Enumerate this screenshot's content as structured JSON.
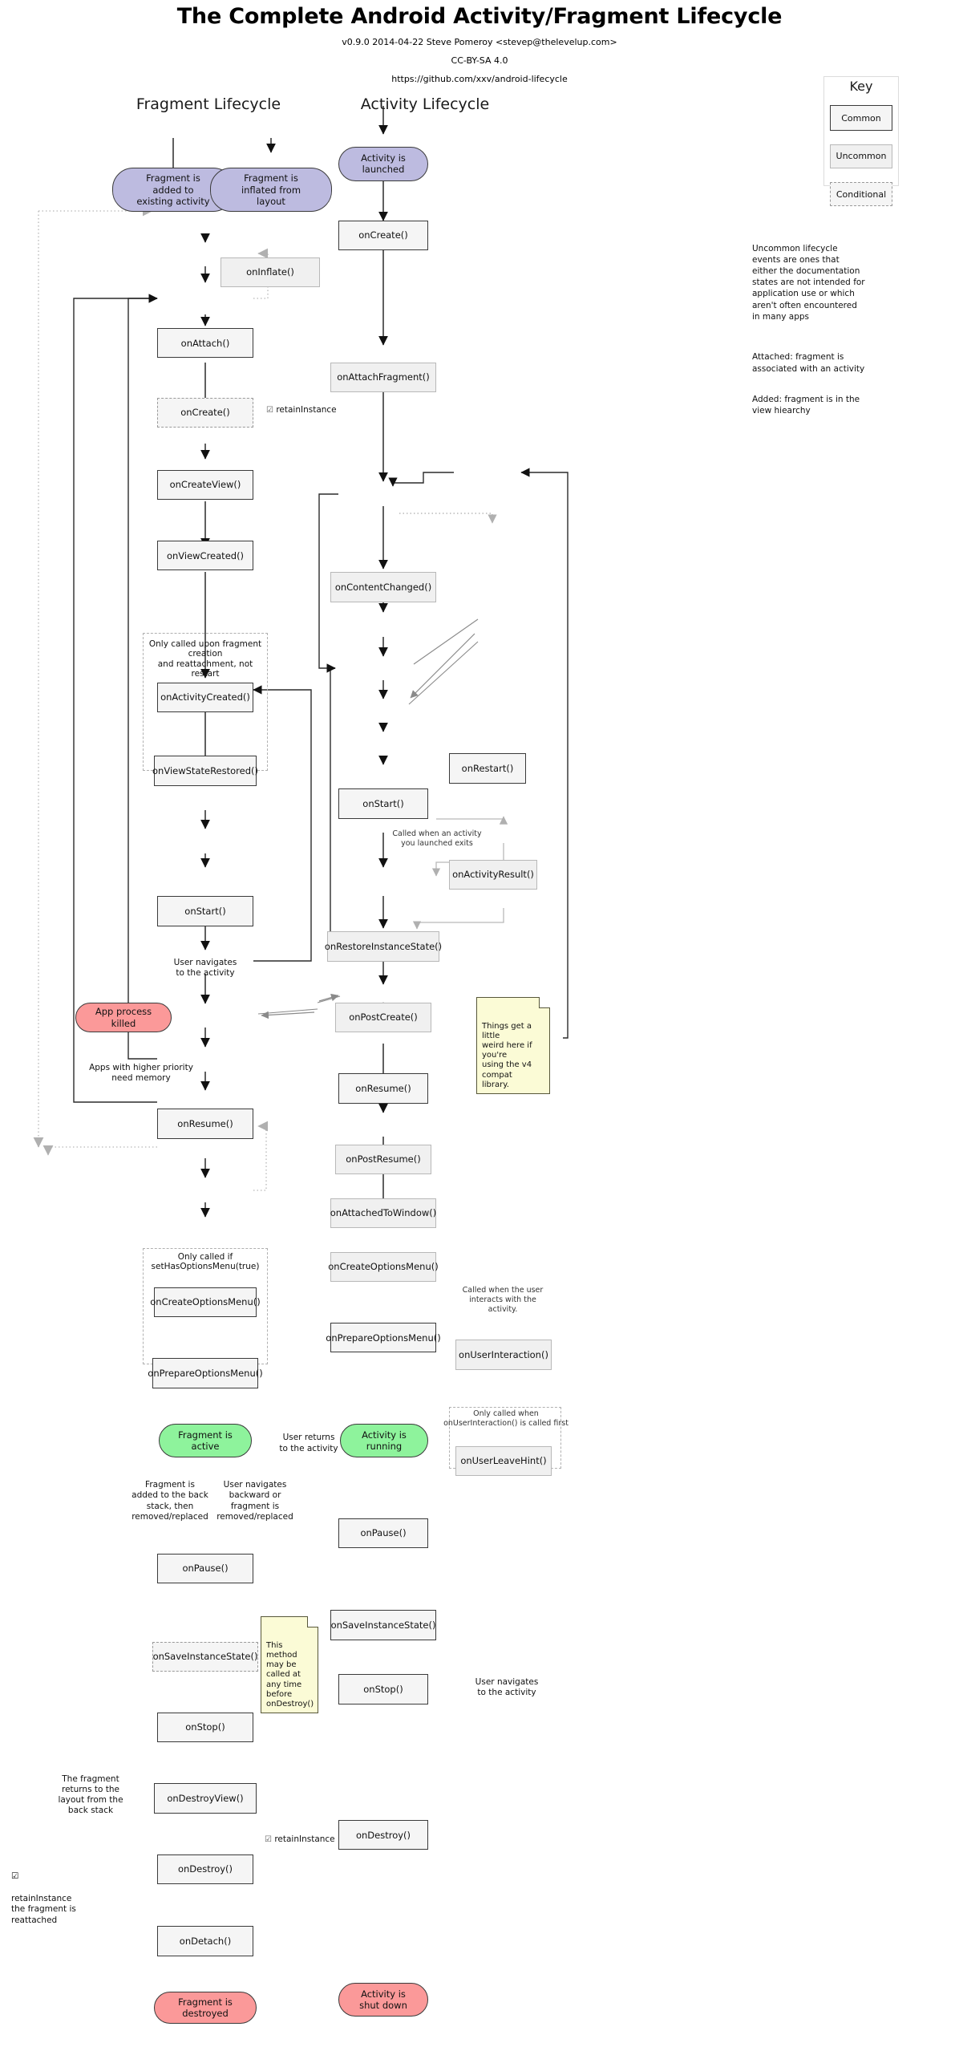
{
  "header": {
    "title": "The Complete Android Activity/Fragment Lifecycle",
    "version_line": "v0.9.0 2014-04-22 Steve Pomeroy <stevep@thelevelup.com>",
    "license_line": "CC-BY-SA 4.0",
    "url_line": "https://github.com/xxv/android-lifecycle"
  },
  "columns": {
    "fragment_title": "Fragment Lifecycle",
    "activity_title": "Activity Lifecycle"
  },
  "key": {
    "title": "Key",
    "items": [
      {
        "label": "Common",
        "style": "common"
      },
      {
        "label": "Uncommon",
        "style": "uncommon"
      },
      {
        "label": "Conditional",
        "style": "conditional"
      }
    ]
  },
  "notes_panel": {
    "uncommon_desc": "Uncommon lifecycle\nevents are ones that\neither the documentation\nstates are not intended for\napplication use or which\naren't often encountered\nin many apps",
    "attached_desc": "Attached: fragment is\nassociated with an activity",
    "added_desc": "Added: fragment is in the\nview hiearchy"
  },
  "fragment": {
    "start_added": "Fragment is\nadded to\nexisting activity",
    "start_inflated": "Fragment is\ninflated from\nlayout",
    "on_inflate": "onInflate()",
    "on_attach": "onAttach()",
    "on_create": "onCreate()",
    "on_create_view": "onCreateView()",
    "on_view_created": "onViewCreated()",
    "group_creation_label": "Only called upon fragment creation\nand reattachment, not restart",
    "on_activity_created": "onActivityCreated()",
    "on_view_state_restored": "onViewStateRestored()",
    "on_start": "onStart()",
    "label_user_navigates": "User navigates\nto the activity",
    "app_process_killed": "App process\nkilled",
    "label_higher_priority": "Apps with higher priority\nneed memory",
    "on_resume": "onResume()",
    "group_options_menu_label": "Only called if\nsetHasOptionsMenu(true)",
    "on_create_options_menu": "onCreateOptionsMenu()",
    "on_prepare_options_menu": "onPrepareOptionsMenu()",
    "fragment_active": "Fragment is\nactive",
    "label_back_stack": "Fragment is\nadded to the back\nstack, then\nremoved/replaced",
    "label_navigates_backward": "User navigates\nbackward or\nfragment is\nremoved/replaced",
    "on_pause": "onPause()",
    "on_save_instance_state": "onSaveInstanceState()",
    "note_save_state": "This method\nmay be called at\nany time before\nonDestroy()",
    "on_stop": "onStop()",
    "label_returns_layout": "The fragment\nreturns to the\nlayout from the\nback stack",
    "on_destroy_view": "onDestroyView()",
    "on_destroy": "onDestroy()",
    "on_detach": "onDetach()",
    "fragment_destroyed": "Fragment is\ndestroyed",
    "retain_instance": "retainInstance",
    "retain_checkbox": "☑",
    "retain_reattached": "retainInstance\nthe fragment is\nreattached"
  },
  "activity": {
    "start_launched": "Activity is\nlaunched",
    "on_create": "onCreate()",
    "on_attach_fragment": "onAttachFragment()",
    "on_content_changed": "onContentChanged()",
    "on_start": "onStart()",
    "on_restart": "onRestart()",
    "label_launched_exits": "Called when an activity\nyou launched exits",
    "on_activity_result": "onActivityResult()",
    "on_restore_instance_state": "onRestoreInstanceState()",
    "on_post_create": "onPostCreate()",
    "on_resume": "onResume()",
    "note_v4_compat": "Things get a little\nweird here if you're\nusing the v4 compat\nlibrary.",
    "on_post_resume": "onPostResume()",
    "on_attached_to_window": "onAttachedToWindow()",
    "on_create_options_menu": "onCreateOptionsMenu()",
    "on_prepare_options_menu": "onPrepareOptionsMenu()",
    "label_user_interacts": "Called when the user\ninteracts with the\nactivity.",
    "on_user_interaction": "onUserInteraction()",
    "label_only_called_when": "Only called when\nonUserInteraction() is called first",
    "on_user_leave_hint": "onUserLeaveHint()",
    "activity_running": "Activity is\nrunning",
    "label_user_returns": "User returns\nto the activity",
    "on_pause": "onPause()",
    "on_save_instance_state": "onSaveInstanceState()",
    "on_stop": "onStop()",
    "label_user_navigates": "User navigates\nto the activity",
    "on_destroy": "onDestroy()",
    "activity_shut_down": "Activity is\nshut down"
  },
  "colors": {
    "start_fill": "#bdbbe0",
    "end_fill": "#fb9999",
    "active_fill": "#8ef39c",
    "common_fill": "#f5f5f5",
    "note_fill": "#fbfbd6"
  }
}
